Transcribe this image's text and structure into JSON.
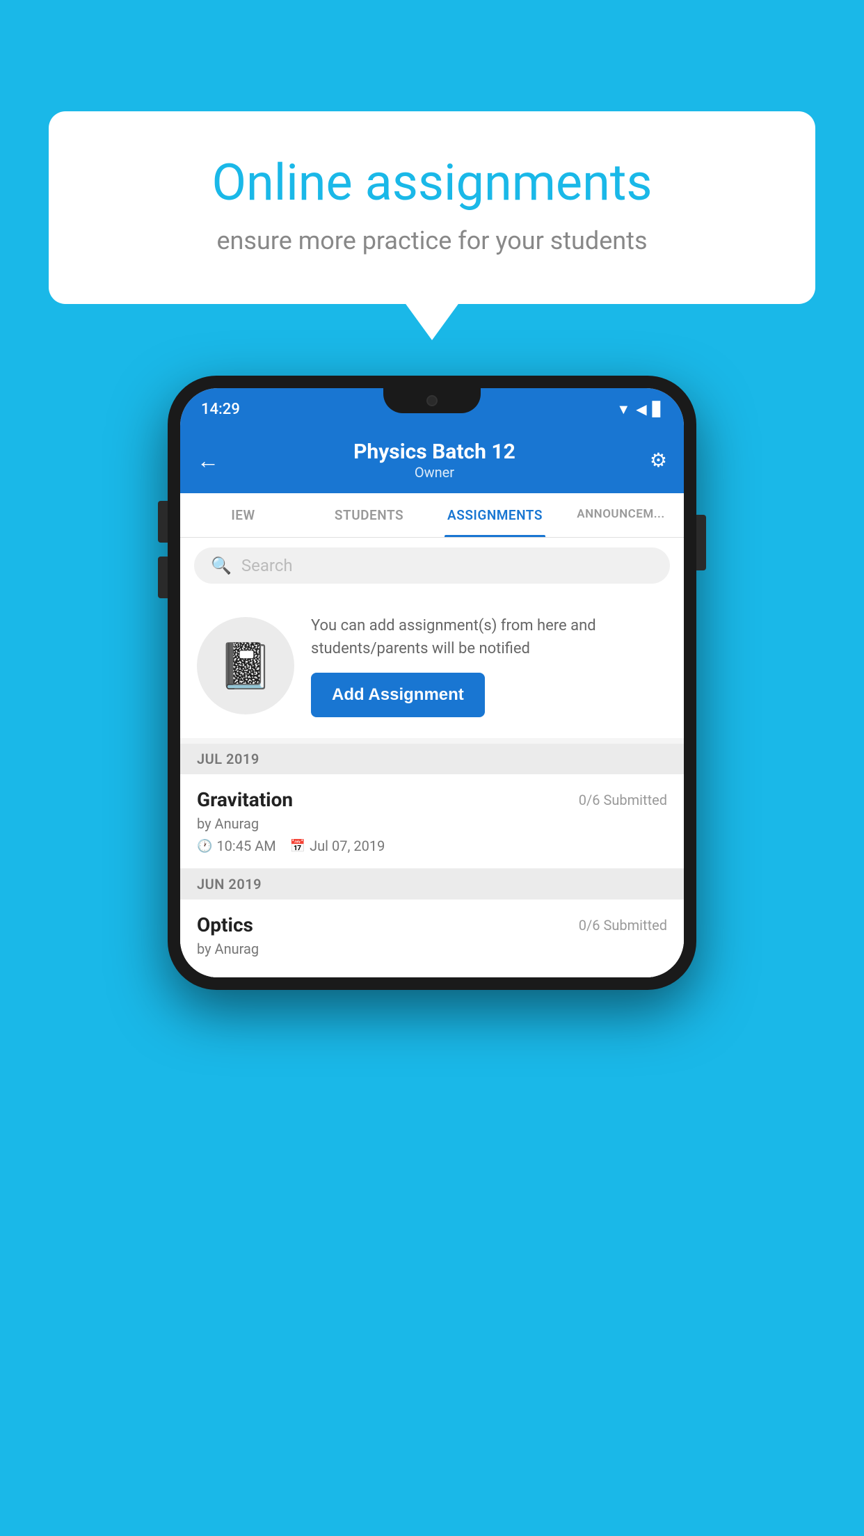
{
  "background": {
    "color": "#1ab8e8"
  },
  "speech_bubble": {
    "title": "Online assignments",
    "subtitle": "ensure more practice for your students"
  },
  "phone": {
    "status_bar": {
      "time": "14:29",
      "icons": [
        "▲",
        "▲",
        "▊"
      ]
    },
    "header": {
      "title": "Physics Batch 12",
      "subtitle": "Owner",
      "back_label": "←",
      "settings_label": "⚙"
    },
    "tabs": [
      {
        "label": "IEW",
        "active": false
      },
      {
        "label": "STUDENTS",
        "active": false
      },
      {
        "label": "ASSIGNMENTS",
        "active": true
      },
      {
        "label": "ANNOUNCEM...",
        "active": false
      }
    ],
    "search": {
      "placeholder": "Search",
      "icon": "🔍"
    },
    "promo": {
      "description": "You can add assignment(s) from here and students/parents will be notified",
      "button_label": "Add Assignment"
    },
    "sections": [
      {
        "header": "JUL 2019",
        "assignments": [
          {
            "name": "Gravitation",
            "submitted": "0/6 Submitted",
            "by": "by Anurag",
            "time": "10:45 AM",
            "date": "Jul 07, 2019"
          }
        ]
      },
      {
        "header": "JUN 2019",
        "assignments": [
          {
            "name": "Optics",
            "submitted": "0/6 Submitted",
            "by": "by Anurag",
            "time": "",
            "date": ""
          }
        ]
      }
    ]
  }
}
